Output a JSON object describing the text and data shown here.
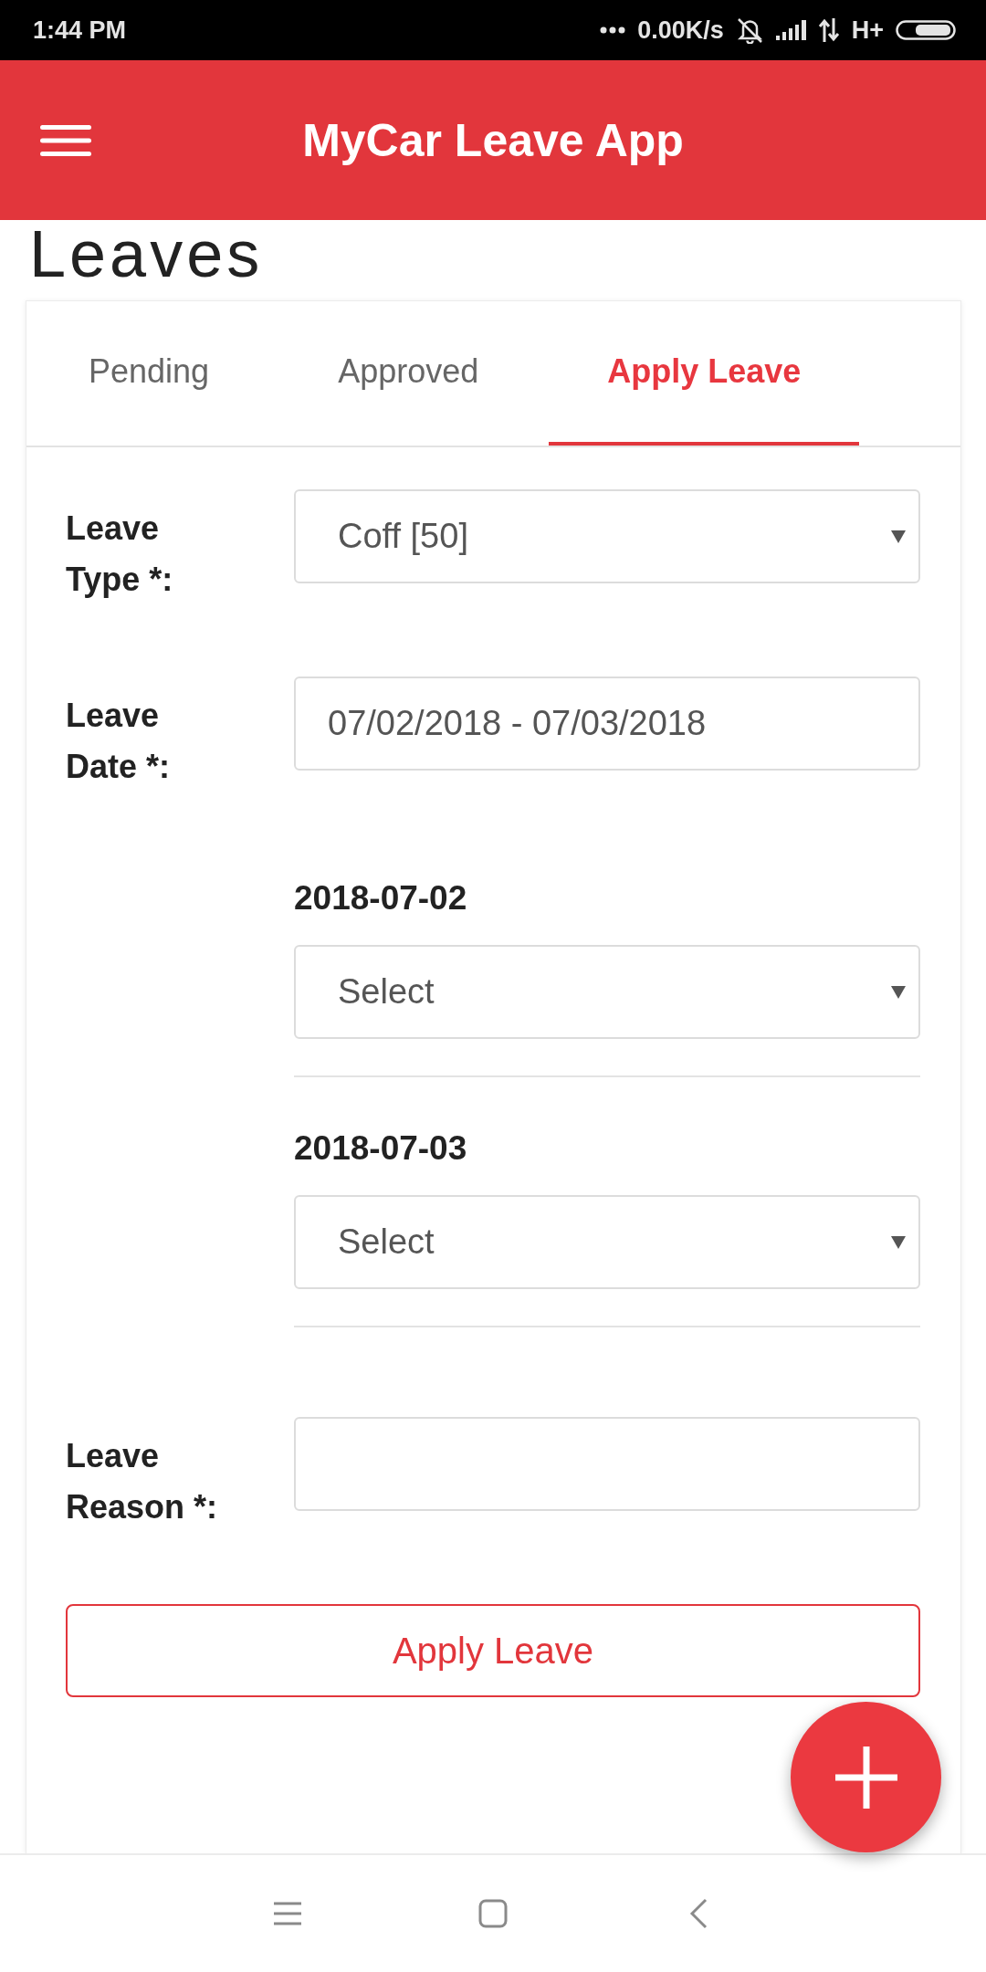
{
  "status_bar": {
    "time": "1:44 PM",
    "network_speed": "0.00K/s",
    "network_type": "H+"
  },
  "app_bar": {
    "title": "MyCar Leave App"
  },
  "page": {
    "heading": "Leaves"
  },
  "tabs": [
    {
      "label": "Pending",
      "selected": false
    },
    {
      "label": "Approved",
      "selected": false
    },
    {
      "label": "Apply Leave",
      "selected": true
    }
  ],
  "form": {
    "fields": [
      {
        "kind": "select",
        "label": "Leave Type *:",
        "value": "Coff [50]"
      },
      {
        "kind": "text",
        "label": "Leave Date *:",
        "value": "07/02/2018 - 07/03/2018"
      }
    ],
    "days": [
      {
        "date": "2018-07-02",
        "value": "Select"
      },
      {
        "date": "2018-07-03",
        "value": "Select"
      }
    ],
    "reason": {
      "label": "Leave Reason *:"
    },
    "submit": {
      "label": "Apply Leave"
    }
  }
}
